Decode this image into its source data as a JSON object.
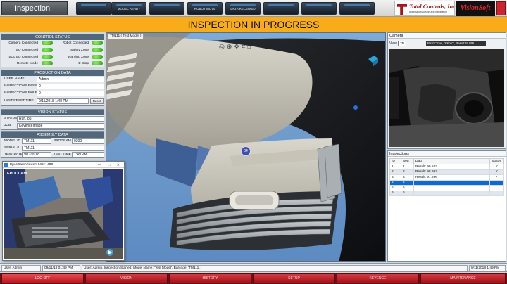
{
  "app": {
    "title": "Inspection"
  },
  "nav": [
    {
      "label": ""
    },
    {
      "label": "MODEL READY"
    },
    {
      "label": ""
    },
    {
      "label": "ROBOT MOVE"
    },
    {
      "label": "DATA RECEIVED"
    },
    {
      "label": ""
    },
    {
      "label": ""
    },
    {
      "label": ""
    }
  ],
  "logos": {
    "tc_name": "Total Controls, Inc.",
    "tc_tag": "Automation Design and Integration",
    "vs_name": "VisionSoft"
  },
  "banner": "INSPECTION IN PROGRESS",
  "control_status": {
    "header": "CONTROL STATUS",
    "items": [
      "Camera Connected",
      "Robot Connected",
      "I/O Connected",
      "Safety Zone",
      "SQL I/O Connected",
      "Warning Zone",
      "Remote Mode",
      "E-Stop"
    ]
  },
  "production": {
    "header": "PRODUCTION DATA",
    "user_name_label": "USER NAME",
    "user_name": "Admin",
    "passed_label": "INSPECTIONS PASSED",
    "passed": "0",
    "failed_label": "INSPECTIONS FAILED",
    "failed": "0",
    "reset_label": "LAST RESET TIME",
    "reset_time": "9/11/2018 1:48 PM",
    "reset_button": "Reset"
  },
  "vision": {
    "header": "VISION STATUS",
    "status_label": "STATUS",
    "status": "Run, 85",
    "job_label": "JOB",
    "job": "KeyenceImage"
  },
  "assembly": {
    "header": "ASSEMBLY DATA",
    "model_label": "MODEL ID",
    "model": "TM111",
    "program_label": "PROGRAM",
    "program": "0300",
    "serial_label": "SERIAL #",
    "serial": "TM111",
    "date_label": "TEST DATE",
    "date": "9/11/2018",
    "time_label": "TEST TIME",
    "time": "1:49 PM"
  },
  "epoc": {
    "title": "EpocCam Viewer: 640 × 480",
    "brand": "EPOCCAM"
  },
  "viewport": {
    "label": "TM111 ( Test Model )",
    "marker": "04"
  },
  "camera": {
    "header": "Camera",
    "view_label": "View",
    "view_value": "2D",
    "result_text": "PASS:True, OptionX, Result:97.896"
  },
  "inspections": {
    "header": "Inspections",
    "columns": [
      "ID",
      "Seq",
      "Data",
      "Status"
    ],
    "rows": [
      {
        "id": "1",
        "seq": "1",
        "data": "Result: 99.503",
        "status": "✓"
      },
      {
        "id": "2",
        "seq": "2",
        "data": "Result: 98.997",
        "status": "✓"
      },
      {
        "id": "3",
        "seq": "3",
        "data": "Result: 97.896",
        "status": "✓"
      },
      {
        "id": "4",
        "seq": "4",
        "data": "",
        "status": ""
      },
      {
        "id": "5",
        "seq": "5",
        "data": "",
        "status": ""
      },
      {
        "id": "6",
        "seq": "6",
        "data": "",
        "status": ""
      }
    ]
  },
  "statusbar": {
    "user": "User: Admin",
    "time": "09/11/18 01:49 PM",
    "message": "User: Admin, Inspection Started. Model Name: 'Test Model'. Barcode: 'TM111'.",
    "right": "9/11/2018 1:49 PM"
  },
  "tabs": [
    "LOG OFF",
    "VISION",
    "HISTORY",
    "SETUP",
    "KEYENCE",
    "MAINTENANCE"
  ]
}
